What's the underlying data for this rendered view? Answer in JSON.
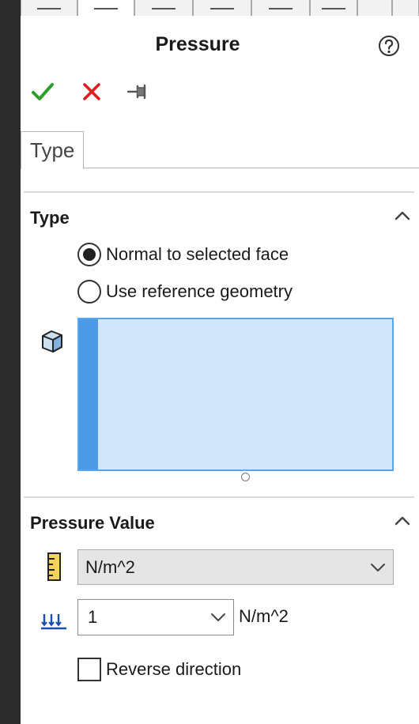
{
  "header": {
    "title": "Pressure"
  },
  "icons": {
    "help": "help-icon",
    "ok": "checkmark-icon",
    "cancel": "close-icon",
    "pin": "pushpin-icon",
    "face": "face-selection-icon",
    "units": "ruler-icon",
    "value": "pressure-arrows-icon"
  },
  "colors": {
    "ok": "#2e9e2e",
    "cancel": "#e01e1e",
    "selection_box": "#d3e5f8",
    "selection_border": "#5aa5ee"
  },
  "tabs": [
    {
      "label": "Type",
      "active": true
    }
  ],
  "type_section": {
    "title": "Type",
    "options": [
      {
        "label": "Normal to selected face",
        "selected": true
      },
      {
        "label": "Use reference geometry",
        "selected": false
      }
    ],
    "selection_box_items": []
  },
  "pressure_section": {
    "title": "Pressure Value",
    "unit_select": {
      "value": "N/m^2"
    },
    "value_select": {
      "value": "1",
      "unit": "N/m^2"
    },
    "reverse_direction": {
      "label": "Reverse direction",
      "checked": false
    }
  }
}
